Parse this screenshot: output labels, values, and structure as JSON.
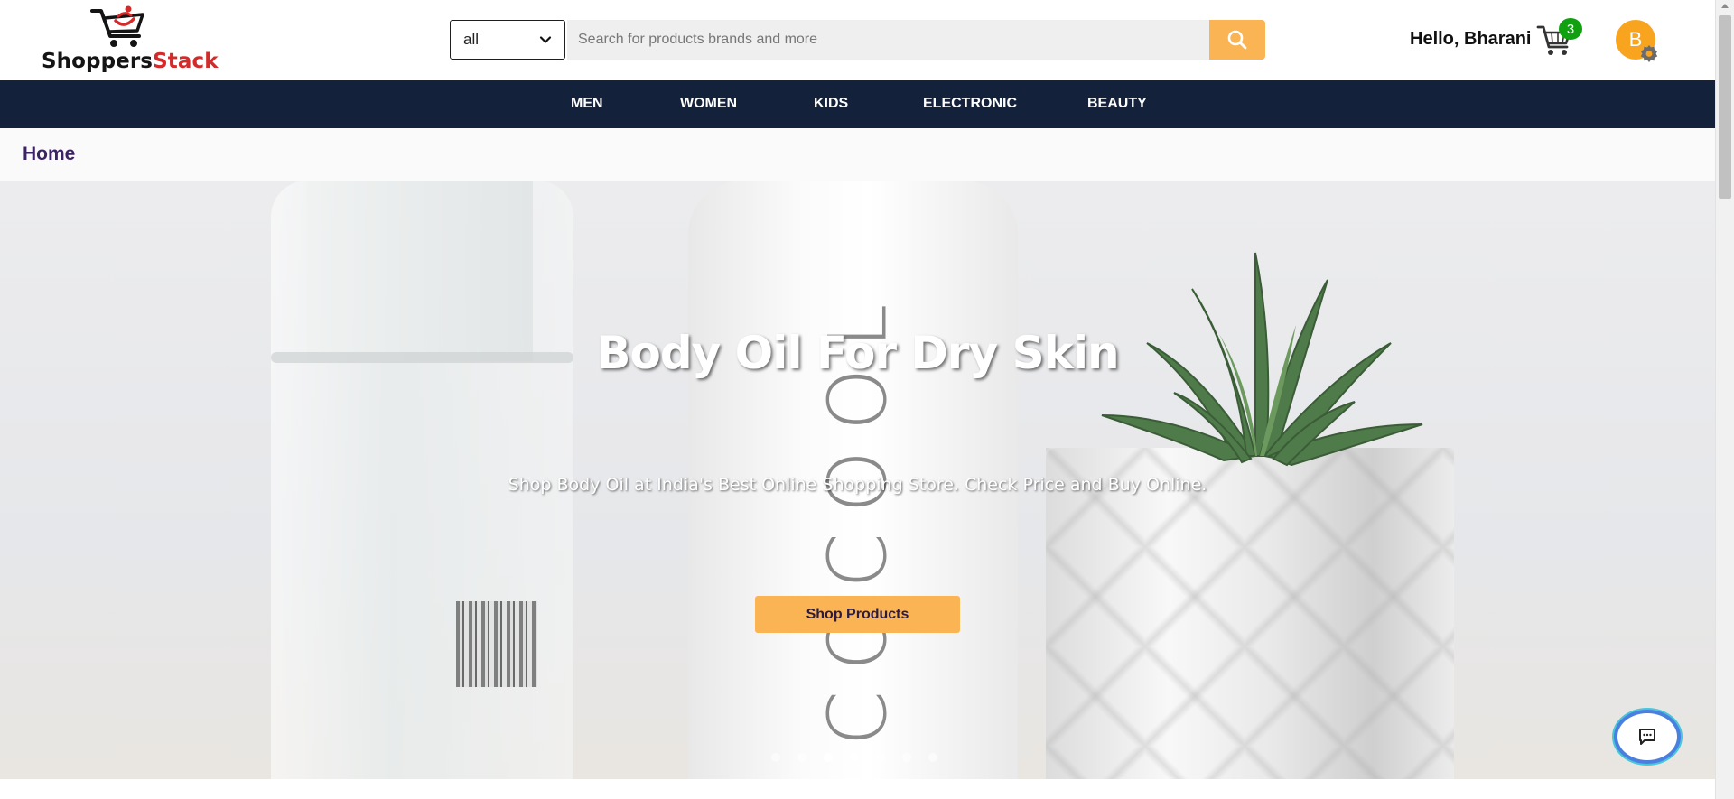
{
  "brand": {
    "name_part1": "Shoppers",
    "name_part2": "Stack",
    "colors": {
      "dark": "#141414",
      "accent": "#d42a2a"
    }
  },
  "search": {
    "category_selected": "all",
    "placeholder": "Search for products brands and more",
    "button_icon": "search-icon",
    "button_color": "#fbb454"
  },
  "user": {
    "greeting": "Hello, Bharani",
    "avatar_initial": "B",
    "avatar_color": "#f8a41e",
    "cart_count": "3"
  },
  "nav": {
    "items": [
      "MEN",
      "WOMEN",
      "KIDS",
      "ELECTRONIC",
      "BEAUTY"
    ],
    "background": "#14213a"
  },
  "breadcrumb": {
    "label": "Home"
  },
  "hero": {
    "title": "Body Oil For Dry Skin",
    "subtitle": "Shop Body Oil at India's Best Online Shopping Store. Check Price and Buy Online.",
    "cta_label": "Shop Products",
    "bottle_text": "COCOOL",
    "carousel": {
      "total_slides": 7,
      "active_index": 2
    }
  },
  "chat": {
    "icon": "chat-icon"
  }
}
